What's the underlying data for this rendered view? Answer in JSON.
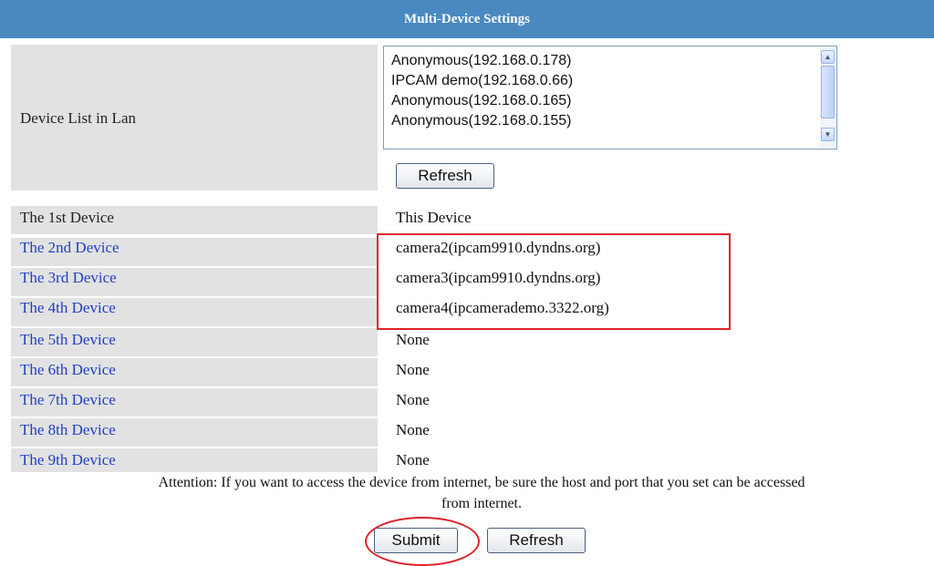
{
  "header": {
    "title": "Multi-Device Settings"
  },
  "lan": {
    "label": "Device List in Lan",
    "items": [
      "Anonymous(192.168.0.178)",
      "IPCAM demo(192.168.0.66)",
      "Anonymous(192.168.0.165)",
      "Anonymous(192.168.0.155)"
    ],
    "refresh_label": "Refresh"
  },
  "devices": [
    {
      "label": "The 1st Device",
      "value": "This Device"
    },
    {
      "label": "The 2nd Device",
      "value": "camera2(ipcam9910.dyndns.org)"
    },
    {
      "label": "The 3rd Device",
      "value": "camera3(ipcam9910.dyndns.org)"
    },
    {
      "label": "The 4th Device",
      "value": "camera4(ipcamerademo.3322.org)"
    },
    {
      "label": "The 5th Device",
      "value": "None"
    },
    {
      "label": "The 6th Device",
      "value": "None"
    },
    {
      "label": "The 7th Device",
      "value": "None"
    },
    {
      "label": "The 8th Device",
      "value": "None"
    },
    {
      "label": "The 9th Device",
      "value": "None"
    }
  ],
  "attention": {
    "line1": "Attention: If you want to access the device from internet, be sure the host and port that you set can be accessed",
    "line2": "from internet."
  },
  "actions": {
    "submit_label": "Submit",
    "refresh_label": "Refresh"
  },
  "colors": {
    "header": "#4a89c0",
    "label_bg": "#e2e2e2",
    "link": "#1f3fc4",
    "highlight": "#e0222a"
  }
}
